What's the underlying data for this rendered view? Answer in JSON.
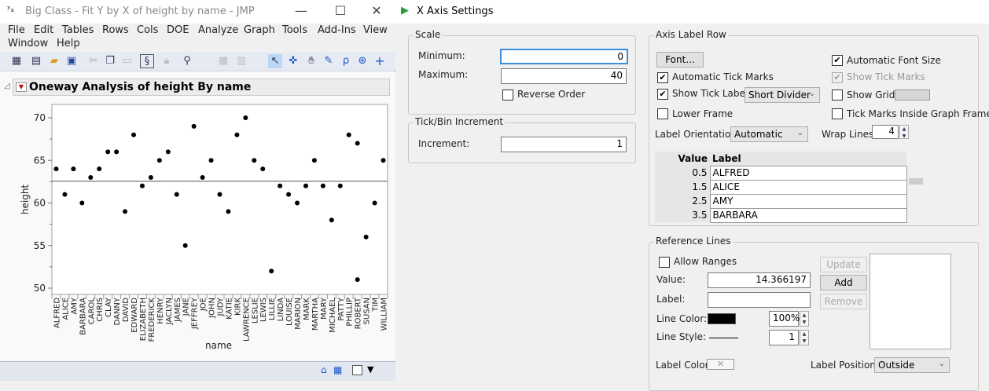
{
  "left_window": {
    "title": "Big Class - Fit Y by X of height by name - JMP",
    "controls": {
      "minimize": "—",
      "maximize": "☐",
      "close": "✕"
    },
    "menu": [
      "File",
      "Edit",
      "Tables",
      "Rows",
      "Cols",
      "DOE",
      "Analyze",
      "Graph",
      "Tools",
      "Add-Ins",
      "View",
      "Window",
      "Help"
    ],
    "report_title": "Oneway Analysis of height By name"
  },
  "chart_data": {
    "type": "scatter",
    "title": "Oneway Analysis of height By name",
    "xlabel": "name",
    "ylabel": "height",
    "ylim": [
      49.5,
      71
    ],
    "yticks": [
      50,
      55,
      60,
      65,
      70
    ],
    "categories": [
      "ALFRED",
      "ALICE",
      "AMY",
      "BARBARA",
      "CAROL",
      "CHRIS",
      "CLAY",
      "DANNY",
      "DAVID",
      "EDWARD",
      "ELIZABETH",
      "FREDERICK",
      "HENRY",
      "JACLYN",
      "JAMES",
      "JANE",
      "JEFFREY",
      "JOE",
      "JOHN",
      "JUDY",
      "KATIE",
      "KIRK",
      "LAWRENCE",
      "LESLIE",
      "LEWIS",
      "LILLIE",
      "LINDA",
      "LOUISE",
      "MARION",
      "MARK",
      "MARTHA",
      "MARY",
      "MICHAEL",
      "PATTY",
      "PHILLIP",
      "ROBERT",
      "SUSAN",
      "TIM",
      "WILLIAM"
    ],
    "points": [
      [
        0,
        64
      ],
      [
        1,
        61
      ],
      [
        2,
        64
      ],
      [
        3,
        60
      ],
      [
        4,
        63
      ],
      [
        5,
        64
      ],
      [
        6,
        66
      ],
      [
        7,
        66
      ],
      [
        8,
        59
      ],
      [
        9,
        68
      ],
      [
        10,
        62
      ],
      [
        11,
        63
      ],
      [
        12,
        65
      ],
      [
        13,
        66
      ],
      [
        14,
        61
      ],
      [
        15,
        55
      ],
      [
        16,
        69
      ],
      [
        17,
        63
      ],
      [
        18,
        65
      ],
      [
        19,
        61
      ],
      [
        20,
        59
      ],
      [
        21,
        68
      ],
      [
        22,
        70
      ],
      [
        23,
        65
      ],
      [
        24,
        64
      ],
      [
        25,
        52
      ],
      [
        26,
        62
      ],
      [
        27,
        61
      ],
      [
        28,
        60
      ],
      [
        29,
        62
      ],
      [
        30,
        65
      ],
      [
        31,
        62
      ],
      [
        32,
        58
      ],
      [
        33,
        62
      ],
      [
        34,
        68
      ],
      [
        35,
        67
      ],
      [
        35,
        51
      ],
      [
        36,
        56
      ],
      [
        37,
        60
      ],
      [
        38,
        65
      ]
    ],
    "mean_line": 62.55,
    "grid": false
  },
  "dialog": {
    "title": "X Axis Settings",
    "scale": {
      "title": "Scale",
      "min_label": "Minimum:",
      "min_value": "0",
      "max_label": "Maximum:",
      "max_value": "40",
      "reverse_label": "Reverse Order"
    },
    "tick": {
      "title": "Tick/Bin Increment",
      "inc_label": "Increment:",
      "inc_value": "1"
    },
    "axis_label_row": {
      "title": "Axis Label Row",
      "font_btn": "Font...",
      "auto_tick_marks": "Automatic Tick Marks",
      "show_tick_labels": "Show Tick Labels",
      "divider_select": "Short Divider",
      "lower_frame": "Lower Frame",
      "auto_font_size": "Automatic Font Size",
      "show_tick_marks": "Show Tick Marks",
      "show_grid": "Show Grid",
      "tick_inside": "Tick Marks Inside Graph Frame",
      "orientation_label": "Label Orientation",
      "orientation_value": "Automatic",
      "wrap_label": "Wrap Lines",
      "wrap_value": "4",
      "table_headers": [
        "Value",
        "Label"
      ],
      "rows": [
        {
          "value": "0.5",
          "label": "ALFRED"
        },
        {
          "value": "1.5",
          "label": "ALICE"
        },
        {
          "value": "2.5",
          "label": "AMY"
        },
        {
          "value": "3.5",
          "label": "BARBARA"
        }
      ]
    },
    "reference_lines": {
      "title": "Reference Lines",
      "allow_ranges": "Allow Ranges",
      "value_label": "Value:",
      "value": "14.366197",
      "label_label": "Label:",
      "label_value": "",
      "line_color_label": "Line Color:",
      "line_color": "#000000",
      "opacity": "100%",
      "line_style_label": "Line Style:",
      "line_width": "1",
      "update_btn": "Update",
      "add_btn": "Add",
      "remove_btn": "Remove",
      "label_color_label": "Label Color",
      "label_position_label": "Label Position",
      "label_position_value": "Outside"
    }
  }
}
